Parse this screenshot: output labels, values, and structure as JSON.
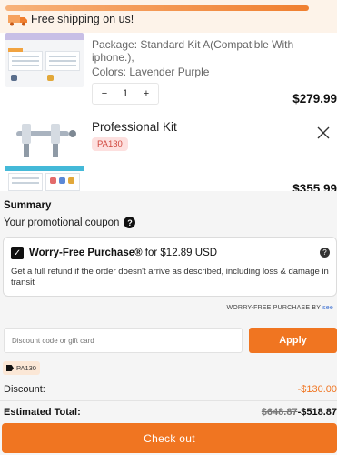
{
  "banner": {
    "text": "Free shipping on us!"
  },
  "items": [
    {
      "package": "Package: Standard Kit A(Compatible With iphone.),",
      "colors": "Colors: Lavender Purple",
      "quantity": "1",
      "price": "$279.99"
    },
    {
      "title": "Professional Kit",
      "code": "PA130",
      "price": "$355.99"
    }
  ],
  "summary": {
    "title": "Summary",
    "coupon_label": "Your promotional coupon",
    "worry_free": {
      "title": "Worry-Free Purchase®",
      "price_text": " for $12.89 USD",
      "description": "Get a full refund if the order doesn't arrive as described, including loss & damage in transit",
      "checked": true
    },
    "worry_free_by": "WORRY-FREE PURCHASE BY",
    "worry_free_by_brand": "see",
    "discount_placeholder": "Discount code or gift card",
    "apply_label": "Apply",
    "applied_code": "PA130",
    "discount_label": "Discount:",
    "discount_value": "-$130.00",
    "total_label": "Estimated Total:",
    "total_original": "$648.87",
    "total_final": "-$518.87",
    "checkout_label": "Check out"
  },
  "colors": {
    "accent": "#f07521",
    "badge_bg": "#fde0df",
    "badge_text": "#d0473e"
  }
}
